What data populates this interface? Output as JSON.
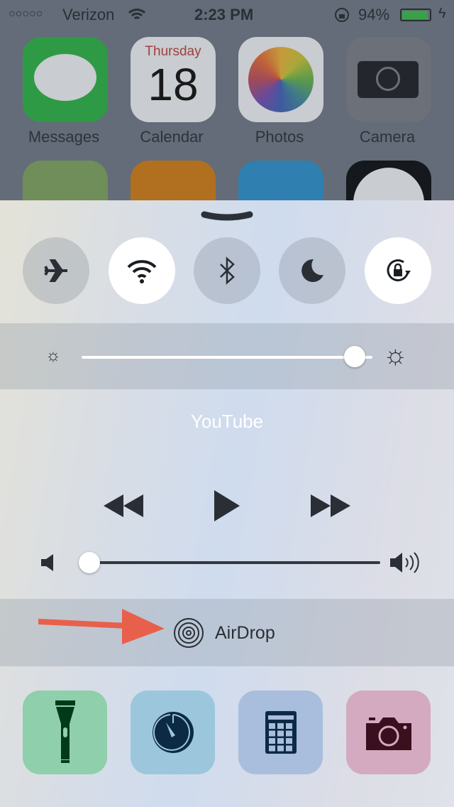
{
  "status_bar": {
    "signal": "○○○○○",
    "carrier": "Verizon",
    "time": "2:23 PM",
    "battery": "94%",
    "battery_level": 0.94,
    "icons": [
      "wifi-icon",
      "rotation-lock-icon",
      "battery-icon",
      "charging-icon"
    ]
  },
  "home_apps": [
    {
      "label": "Messages",
      "color": "#2f9a45"
    },
    {
      "label": "Calendar",
      "day": "Thursday",
      "date": "18",
      "color": "#c9ccd0"
    },
    {
      "label": "Photos",
      "color": "#c9ccd0"
    },
    {
      "label": "Camera",
      "color": "#6b7079"
    }
  ],
  "control_center": {
    "toggles": [
      {
        "name": "airplane-mode",
        "on": false
      },
      {
        "name": "wifi",
        "on": true
      },
      {
        "name": "bluetooth",
        "on": false
      },
      {
        "name": "do-not-disturb",
        "on": false
      },
      {
        "name": "rotation-lock",
        "on": true
      }
    ],
    "brightness": 0.94,
    "media": {
      "title": "YouTube",
      "volume": 0.02
    },
    "airdrop": {
      "label": "AirDrop"
    },
    "shortcuts": [
      {
        "name": "flashlight",
        "color": "#8fcfab"
      },
      {
        "name": "timer",
        "color": "#9cc6dc"
      },
      {
        "name": "calculator",
        "color": "#a8bedc"
      },
      {
        "name": "camera",
        "color": "#d4aac0"
      }
    ],
    "annotation_arrow_color": "#e8604c"
  }
}
